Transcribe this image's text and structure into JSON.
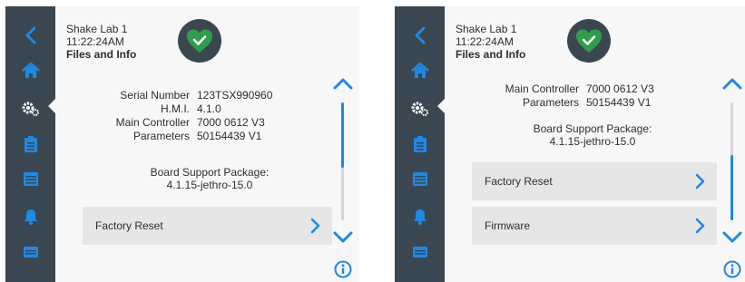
{
  "colors": {
    "accent": "#1e88e5",
    "sidebar": "#3b4750",
    "ok_green": "#2e9e4a",
    "panel": "#e6e6e6"
  },
  "screens": [
    {
      "header": {
        "lab": "Shake Lab 1",
        "time": "11:22:24AM",
        "section": "Files and Info"
      },
      "status_icon": "heart-check-icon",
      "nav": [
        "back-icon",
        "home-icon",
        "settings-icon",
        "clipboard-icon",
        "calendar-icon",
        "bell-icon",
        "display-icon"
      ],
      "info": [
        {
          "key": "Serial Number",
          "value": "123TSX990960"
        },
        {
          "key": "H.M.I.",
          "value": "4.1.0"
        },
        {
          "key": "Main Controller",
          "value": "7000 0612 V3"
        },
        {
          "key": "Parameters",
          "value": "50154439 V1"
        }
      ],
      "bsp_label": "Board Support Package:",
      "bsp_value": "4.1.15-jethro-15.0",
      "menu": [
        {
          "label": "Factory Reset"
        }
      ],
      "scroll_position": 0.0
    },
    {
      "header": {
        "lab": "Shake Lab 1",
        "time": "11:22:24AM",
        "section": "Files and Info"
      },
      "status_icon": "heart-check-icon",
      "nav": [
        "back-icon",
        "home-icon",
        "settings-icon",
        "clipboard-icon",
        "calendar-icon",
        "bell-icon",
        "display-icon"
      ],
      "info": [
        {
          "key": "Main Controller",
          "value": "7000 0612 V3"
        },
        {
          "key": "Parameters",
          "value": "50154439 V1"
        }
      ],
      "bsp_label": "Board Support Package:",
      "bsp_value": "4.1.15-jethro-15.0",
      "menu": [
        {
          "label": "Factory Reset"
        },
        {
          "label": "Firmware"
        }
      ],
      "scroll_position": 0.5
    }
  ]
}
